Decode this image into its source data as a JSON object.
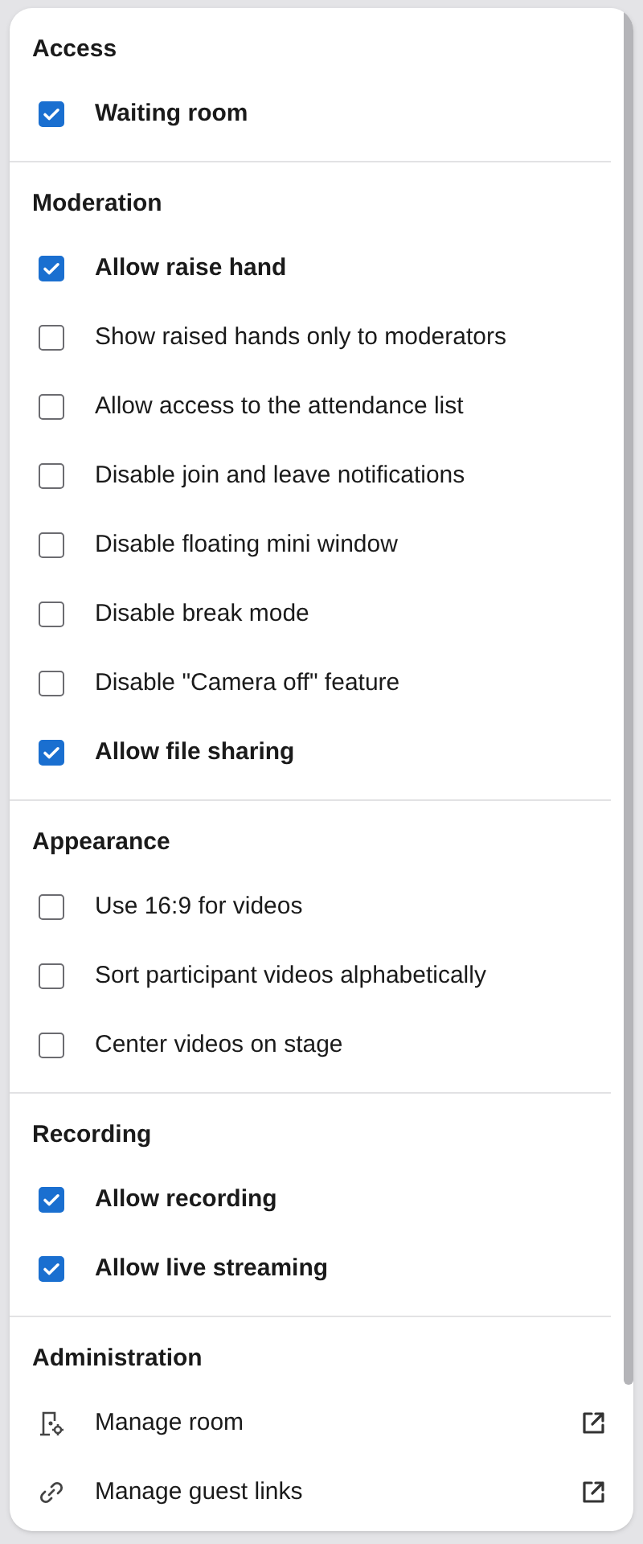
{
  "sections": [
    {
      "title": "Access",
      "items": [
        {
          "kind": "checkbox",
          "label": "Waiting room",
          "checked": true
        }
      ]
    },
    {
      "title": "Moderation",
      "items": [
        {
          "kind": "checkbox",
          "label": "Allow raise hand",
          "checked": true
        },
        {
          "kind": "checkbox",
          "label": "Show raised hands only to moderators",
          "checked": false
        },
        {
          "kind": "checkbox",
          "label": "Allow access to the attendance list",
          "checked": false
        },
        {
          "kind": "checkbox",
          "label": "Disable join and leave notifications",
          "checked": false
        },
        {
          "kind": "checkbox",
          "label": "Disable floating mini window",
          "checked": false
        },
        {
          "kind": "checkbox",
          "label": "Disable break mode",
          "checked": false
        },
        {
          "kind": "checkbox",
          "label": "Disable \"Camera off\" feature",
          "checked": false
        },
        {
          "kind": "checkbox",
          "label": "Allow file sharing",
          "checked": true
        }
      ]
    },
    {
      "title": "Appearance",
      "items": [
        {
          "kind": "checkbox",
          "label": "Use 16:9 for videos",
          "checked": false
        },
        {
          "kind": "checkbox",
          "label": "Sort participant videos alphabetically",
          "checked": false
        },
        {
          "kind": "checkbox",
          "label": "Center videos on stage",
          "checked": false
        }
      ]
    },
    {
      "title": "Recording",
      "items": [
        {
          "kind": "checkbox",
          "label": "Allow recording",
          "checked": true
        },
        {
          "kind": "checkbox",
          "label": "Allow live streaming",
          "checked": true
        }
      ]
    },
    {
      "title": "Administration",
      "items": [
        {
          "kind": "link",
          "label": "Manage room"
        },
        {
          "kind": "link",
          "label": "Manage guest links"
        }
      ]
    }
  ]
}
